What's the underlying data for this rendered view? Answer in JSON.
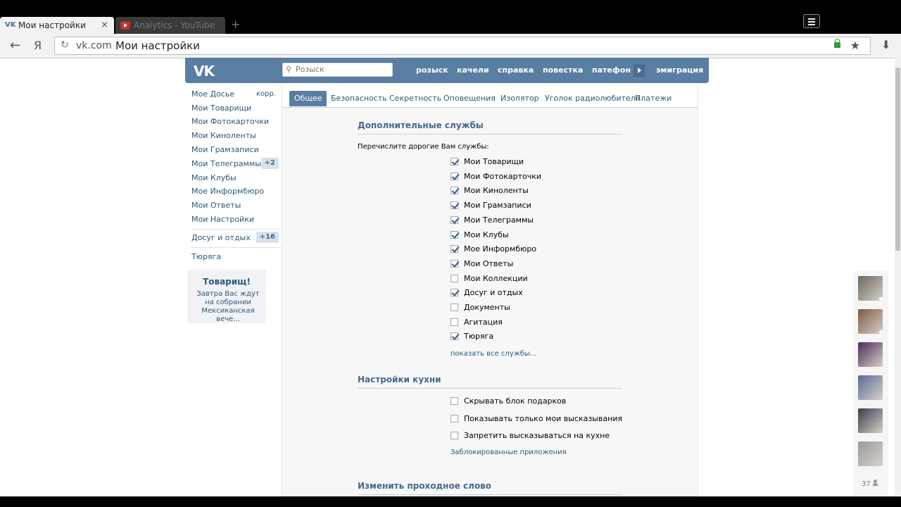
{
  "browser": {
    "tabs": [
      {
        "title": "Мои настройки",
        "favicon": "vk-logo-icon",
        "active": true
      },
      {
        "title": "Analytics - YouTube",
        "favicon": "youtube-icon",
        "active": false
      }
    ],
    "close_glyph": "×",
    "new_tab_glyph": "+",
    "back_glyph": "←",
    "yandex_glyph": "Я",
    "reload_glyph": "↻",
    "url_host": "vk.com",
    "url_title": "Мои настройки",
    "star_glyph": "★",
    "download_glyph": "⬇"
  },
  "header": {
    "logo": "VK",
    "search_placeholder": "Розыск",
    "search_glyph": "⚲",
    "nav": [
      "розыск",
      "качели",
      "справка",
      "повестка",
      "патефон",
      "эмиграция"
    ]
  },
  "left_menu": {
    "items": [
      {
        "label": "Мое Досье",
        "extra": "корр."
      },
      {
        "label": "Мои Товарищи"
      },
      {
        "label": "Мои Фотокарточки"
      },
      {
        "label": "Мои Киноленты"
      },
      {
        "label": "Мои Грамзаписи"
      },
      {
        "label": "Мои Телеграммы",
        "badge": "+2"
      },
      {
        "label": "Мои Клубы"
      },
      {
        "label": "Мое Информбюро"
      },
      {
        "label": "Мои Ответы"
      },
      {
        "label": "Мои Настройки"
      }
    ],
    "leisure": {
      "label": "Досуг и отдых",
      "badge": "+16"
    },
    "jail": {
      "label": "Тюряга"
    },
    "ad": {
      "title": "Товарищ!",
      "text": "Завтра Вас ждут на собрании Мексиканская вече..."
    }
  },
  "settings_tabs": [
    "Общее",
    "Безопасность",
    "Секретность",
    "Оповещения",
    "Изолятор",
    "Уголок радиолюбителя",
    "Платежи"
  ],
  "services": {
    "title": "Дополнительные службы",
    "intro": "Перечислите дорогие Вам службы:",
    "items": [
      {
        "label": "Мои Товарищи",
        "checked": true
      },
      {
        "label": "Мои Фотокарточки",
        "checked": true
      },
      {
        "label": "Мои Киноленты",
        "checked": true
      },
      {
        "label": "Мои Грамзаписи",
        "checked": true
      },
      {
        "label": "Мои Телеграммы",
        "checked": true
      },
      {
        "label": "Мои Клубы",
        "checked": true
      },
      {
        "label": "Мое Информбюро",
        "checked": true
      },
      {
        "label": "Мои Ответы",
        "checked": true
      },
      {
        "label": "Мои Коллекции",
        "checked": false
      },
      {
        "label": "Досуг и отдых",
        "checked": true
      },
      {
        "label": "Документы",
        "checked": false
      },
      {
        "label": "Агитация",
        "checked": false
      },
      {
        "label": "Тюряга",
        "checked": true
      }
    ],
    "show_all": "показать все службы..."
  },
  "kitchen": {
    "title": "Настройки кухни",
    "items": [
      {
        "label": "Скрывать блок подарков",
        "checked": false
      },
      {
        "label": "Показывать только мои высказывания",
        "checked": false
      },
      {
        "label": "Запретить высказываться на кухне",
        "checked": false
      }
    ],
    "blocked_apps": "Заблокированные приложения"
  },
  "password": {
    "title": "Изменить проходное слово"
  },
  "friends": {
    "count": "37",
    "colors": [
      "#6b6560",
      "#7a5a45",
      "#4a2a5a",
      "#5a6a9a",
      "#3a3a4a",
      "#9a9a9a"
    ]
  }
}
